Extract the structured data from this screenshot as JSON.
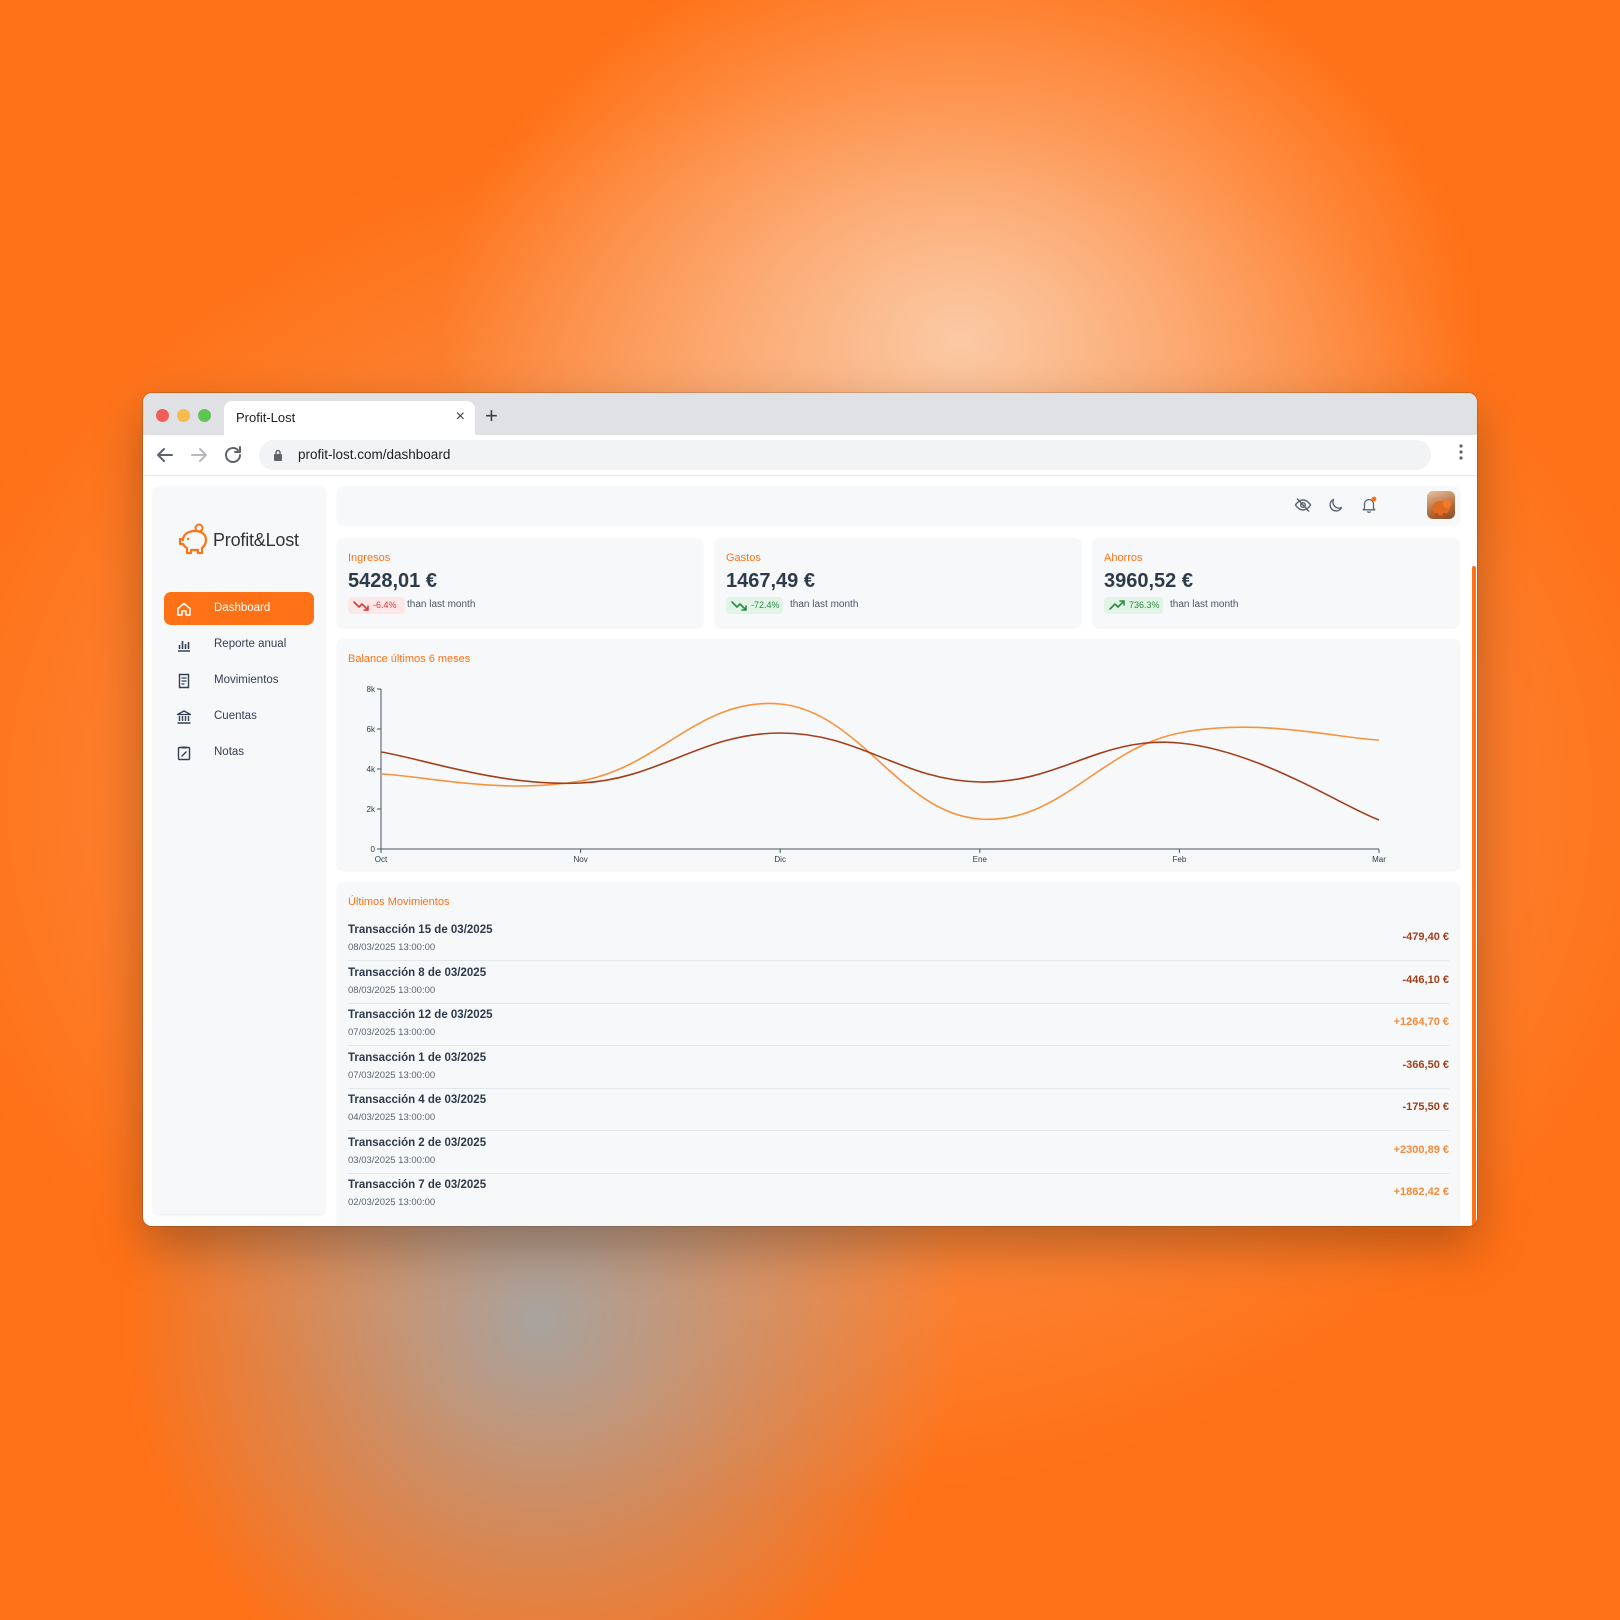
{
  "browser": {
    "tab_title": "Profit-Lost",
    "tab_close": "×",
    "new_tab": "+",
    "url": "profit-lost.com/dashboard"
  },
  "sidebar": {
    "logo_text": "Profit&Lost",
    "items": [
      {
        "label": "Dashboard",
        "icon": "home-icon",
        "active": true
      },
      {
        "label": "Reporte anual",
        "icon": "bar-chart-icon",
        "active": false
      },
      {
        "label": "Movimientos",
        "icon": "receipt-icon",
        "active": false
      },
      {
        "label": "Cuentas",
        "icon": "bank-icon",
        "active": false
      },
      {
        "label": "Notas",
        "icon": "note-icon",
        "active": false
      }
    ]
  },
  "topbar": {
    "icons": [
      "hide-eye-icon",
      "moon-icon",
      "bell-icon",
      "avatar"
    ]
  },
  "cards": [
    {
      "label": "Ingresos",
      "value": "5428,01 €",
      "change": "-6.4%",
      "trend": "down",
      "suffix": "than last month"
    },
    {
      "label": "Gastos",
      "value": "1467,49 €",
      "change": "-72.4%",
      "trend": "down",
      "suffix": "than last month"
    },
    {
      "label": "Ahorros",
      "value": "3960,52 €",
      "change": "736.3%",
      "trend": "up",
      "suffix": "than last month"
    }
  ],
  "chart_title": "Balance últimos 6 meses",
  "chart_data": {
    "type": "line",
    "x": [
      "Oct",
      "Nov",
      "Dic",
      "Ene",
      "Feb",
      "Mar"
    ],
    "yticks": [
      "0",
      "2k",
      "4k",
      "6k",
      "8k"
    ],
    "ylim": [
      0,
      8000
    ],
    "series": [
      {
        "color": "#f5943f",
        "values": [
          3750,
          3400,
          7250,
          1500,
          5800,
          5450
        ]
      },
      {
        "color": "#a13f1c",
        "values": [
          4850,
          3300,
          5800,
          3350,
          5300,
          1450
        ]
      }
    ],
    "grid": false,
    "legend": "none"
  },
  "movements": {
    "title": "Últimos Movimientos",
    "rows": [
      {
        "name": "Transacción 15 de 03/2025",
        "date": "08/03/2025 13:00:00",
        "amount": "-479,40 €",
        "sign": "neg"
      },
      {
        "name": "Transacción 8 de 03/2025",
        "date": "08/03/2025 13:00:00",
        "amount": "-446,10 €",
        "sign": "neg"
      },
      {
        "name": "Transacción 12 de 03/2025",
        "date": "07/03/2025 13:00:00",
        "amount": "+1264,70 €",
        "sign": "pos"
      },
      {
        "name": "Transacción 1 de 03/2025",
        "date": "07/03/2025 13:00:00",
        "amount": "-366,50 €",
        "sign": "neg"
      },
      {
        "name": "Transacción 4 de 03/2025",
        "date": "04/03/2025 13:00:00",
        "amount": "-175,50 €",
        "sign": "neg"
      },
      {
        "name": "Transacción 2 de 03/2025",
        "date": "03/03/2025 13:00:00",
        "amount": "+2300,89 €",
        "sign": "pos"
      },
      {
        "name": "Transacción 7 de 03/2025",
        "date": "02/03/2025 13:00:00",
        "amount": "+1862,42 €",
        "sign": "pos"
      }
    ]
  },
  "colors": {
    "accent": "#ff7116",
    "negative_amount": "#a1401a",
    "positive_amount": "#f58a3a"
  }
}
